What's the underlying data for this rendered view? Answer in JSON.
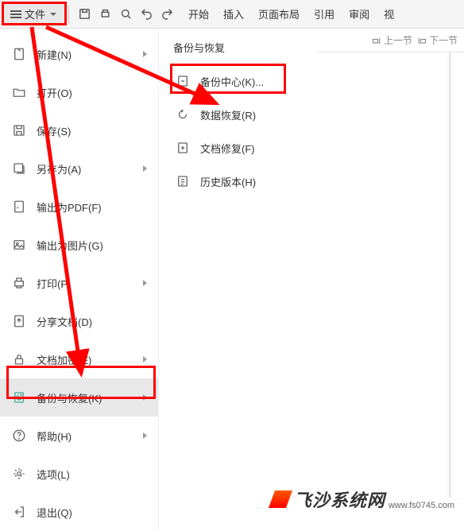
{
  "toolbar": {
    "file_label": "文件",
    "tabs": [
      "开始",
      "插入",
      "页面布局",
      "引用",
      "审阅",
      "视"
    ]
  },
  "subbar": {
    "prev": "上一节",
    "next": "下一节"
  },
  "menu": {
    "items": [
      {
        "label": "新建(N)",
        "arrow": true,
        "icon": "new"
      },
      {
        "label": "打开(O)",
        "arrow": false,
        "icon": "open"
      },
      {
        "label": "保存(S)",
        "arrow": false,
        "icon": "save"
      },
      {
        "label": "另存为(A)",
        "arrow": true,
        "icon": "saveas"
      },
      {
        "label": "输出为PDF(F)",
        "arrow": false,
        "icon": "pdf"
      },
      {
        "label": "输出为图片(G)",
        "arrow": false,
        "icon": "image"
      },
      {
        "label": "打印(P)",
        "arrow": true,
        "icon": "print"
      },
      {
        "label": "分享文档(D)",
        "arrow": false,
        "icon": "share"
      },
      {
        "label": "文档加密(E)",
        "arrow": true,
        "icon": "encrypt"
      },
      {
        "label": "备份与恢复(K)",
        "arrow": true,
        "icon": "backup",
        "active": true
      },
      {
        "label": "帮助(H)",
        "arrow": true,
        "icon": "help"
      },
      {
        "label": "选项(L)",
        "arrow": false,
        "icon": "options"
      },
      {
        "label": "退出(Q)",
        "arrow": false,
        "icon": "exit"
      }
    ]
  },
  "submenu": {
    "title": "备份与恢复",
    "items": [
      {
        "label": "备份中心(K)...",
        "icon": "backupcenter"
      },
      {
        "label": "数据恢复(R)",
        "icon": "recover"
      },
      {
        "label": "文档修复(F)",
        "icon": "repair"
      },
      {
        "label": "历史版本(H)",
        "icon": "history"
      }
    ]
  },
  "watermark": {
    "text": "飞沙系统网",
    "url": "www.fs0745.com"
  }
}
